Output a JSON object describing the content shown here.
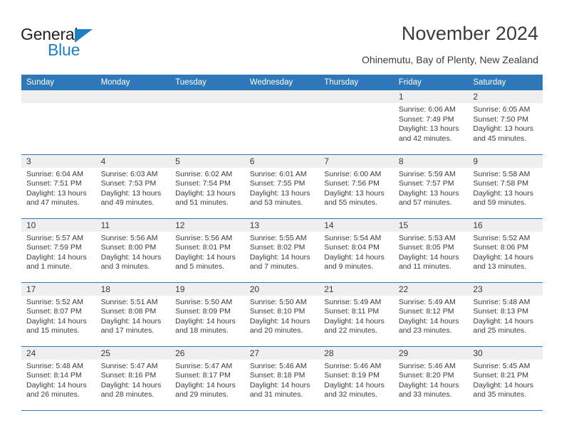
{
  "brand": {
    "logo_text_primary": "General",
    "logo_text_secondary": "Blue",
    "logo_icon": "triangle-icon",
    "primary_color": "#2e77b8",
    "logo_blue": "#1e7fc4",
    "header_bg": "#2e77b8",
    "daynum_bg": "#efefef"
  },
  "header": {
    "title": "November 2024",
    "subtitle": "Ohinemutu, Bay of Plenty, New Zealand"
  },
  "calendar": {
    "weekday_headers": [
      "Sunday",
      "Monday",
      "Tuesday",
      "Wednesday",
      "Thursday",
      "Friday",
      "Saturday"
    ],
    "weeks": [
      [
        {
          "day": "",
          "sunrise": "",
          "sunset": "",
          "daylight1": "",
          "daylight2": "",
          "blank": true
        },
        {
          "day": "",
          "sunrise": "",
          "sunset": "",
          "daylight1": "",
          "daylight2": "",
          "blank": true
        },
        {
          "day": "",
          "sunrise": "",
          "sunset": "",
          "daylight1": "",
          "daylight2": "",
          "blank": true
        },
        {
          "day": "",
          "sunrise": "",
          "sunset": "",
          "daylight1": "",
          "daylight2": "",
          "blank": true
        },
        {
          "day": "",
          "sunrise": "",
          "sunset": "",
          "daylight1": "",
          "daylight2": "",
          "blank": true
        },
        {
          "day": "1",
          "sunrise": "Sunrise: 6:06 AM",
          "sunset": "Sunset: 7:49 PM",
          "daylight1": "Daylight: 13 hours",
          "daylight2": "and 42 minutes.",
          "blank": false
        },
        {
          "day": "2",
          "sunrise": "Sunrise: 6:05 AM",
          "sunset": "Sunset: 7:50 PM",
          "daylight1": "Daylight: 13 hours",
          "daylight2": "and 45 minutes.",
          "blank": false
        }
      ],
      [
        {
          "day": "3",
          "sunrise": "Sunrise: 6:04 AM",
          "sunset": "Sunset: 7:51 PM",
          "daylight1": "Daylight: 13 hours",
          "daylight2": "and 47 minutes.",
          "blank": false
        },
        {
          "day": "4",
          "sunrise": "Sunrise: 6:03 AM",
          "sunset": "Sunset: 7:53 PM",
          "daylight1": "Daylight: 13 hours",
          "daylight2": "and 49 minutes.",
          "blank": false
        },
        {
          "day": "5",
          "sunrise": "Sunrise: 6:02 AM",
          "sunset": "Sunset: 7:54 PM",
          "daylight1": "Daylight: 13 hours",
          "daylight2": "and 51 minutes.",
          "blank": false
        },
        {
          "day": "6",
          "sunrise": "Sunrise: 6:01 AM",
          "sunset": "Sunset: 7:55 PM",
          "daylight1": "Daylight: 13 hours",
          "daylight2": "and 53 minutes.",
          "blank": false
        },
        {
          "day": "7",
          "sunrise": "Sunrise: 6:00 AM",
          "sunset": "Sunset: 7:56 PM",
          "daylight1": "Daylight: 13 hours",
          "daylight2": "and 55 minutes.",
          "blank": false
        },
        {
          "day": "8",
          "sunrise": "Sunrise: 5:59 AM",
          "sunset": "Sunset: 7:57 PM",
          "daylight1": "Daylight: 13 hours",
          "daylight2": "and 57 minutes.",
          "blank": false
        },
        {
          "day": "9",
          "sunrise": "Sunrise: 5:58 AM",
          "sunset": "Sunset: 7:58 PM",
          "daylight1": "Daylight: 13 hours",
          "daylight2": "and 59 minutes.",
          "blank": false
        }
      ],
      [
        {
          "day": "10",
          "sunrise": "Sunrise: 5:57 AM",
          "sunset": "Sunset: 7:59 PM",
          "daylight1": "Daylight: 14 hours",
          "daylight2": "and 1 minute.",
          "blank": false
        },
        {
          "day": "11",
          "sunrise": "Sunrise: 5:56 AM",
          "sunset": "Sunset: 8:00 PM",
          "daylight1": "Daylight: 14 hours",
          "daylight2": "and 3 minutes.",
          "blank": false
        },
        {
          "day": "12",
          "sunrise": "Sunrise: 5:56 AM",
          "sunset": "Sunset: 8:01 PM",
          "daylight1": "Daylight: 14 hours",
          "daylight2": "and 5 minutes.",
          "blank": false
        },
        {
          "day": "13",
          "sunrise": "Sunrise: 5:55 AM",
          "sunset": "Sunset: 8:02 PM",
          "daylight1": "Daylight: 14 hours",
          "daylight2": "and 7 minutes.",
          "blank": false
        },
        {
          "day": "14",
          "sunrise": "Sunrise: 5:54 AM",
          "sunset": "Sunset: 8:04 PM",
          "daylight1": "Daylight: 14 hours",
          "daylight2": "and 9 minutes.",
          "blank": false
        },
        {
          "day": "15",
          "sunrise": "Sunrise: 5:53 AM",
          "sunset": "Sunset: 8:05 PM",
          "daylight1": "Daylight: 14 hours",
          "daylight2": "and 11 minutes.",
          "blank": false
        },
        {
          "day": "16",
          "sunrise": "Sunrise: 5:52 AM",
          "sunset": "Sunset: 8:06 PM",
          "daylight1": "Daylight: 14 hours",
          "daylight2": "and 13 minutes.",
          "blank": false
        }
      ],
      [
        {
          "day": "17",
          "sunrise": "Sunrise: 5:52 AM",
          "sunset": "Sunset: 8:07 PM",
          "daylight1": "Daylight: 14 hours",
          "daylight2": "and 15 minutes.",
          "blank": false
        },
        {
          "day": "18",
          "sunrise": "Sunrise: 5:51 AM",
          "sunset": "Sunset: 8:08 PM",
          "daylight1": "Daylight: 14 hours",
          "daylight2": "and 17 minutes.",
          "blank": false
        },
        {
          "day": "19",
          "sunrise": "Sunrise: 5:50 AM",
          "sunset": "Sunset: 8:09 PM",
          "daylight1": "Daylight: 14 hours",
          "daylight2": "and 18 minutes.",
          "blank": false
        },
        {
          "day": "20",
          "sunrise": "Sunrise: 5:50 AM",
          "sunset": "Sunset: 8:10 PM",
          "daylight1": "Daylight: 14 hours",
          "daylight2": "and 20 minutes.",
          "blank": false
        },
        {
          "day": "21",
          "sunrise": "Sunrise: 5:49 AM",
          "sunset": "Sunset: 8:11 PM",
          "daylight1": "Daylight: 14 hours",
          "daylight2": "and 22 minutes.",
          "blank": false
        },
        {
          "day": "22",
          "sunrise": "Sunrise: 5:49 AM",
          "sunset": "Sunset: 8:12 PM",
          "daylight1": "Daylight: 14 hours",
          "daylight2": "and 23 minutes.",
          "blank": false
        },
        {
          "day": "23",
          "sunrise": "Sunrise: 5:48 AM",
          "sunset": "Sunset: 8:13 PM",
          "daylight1": "Daylight: 14 hours",
          "daylight2": "and 25 minutes.",
          "blank": false
        }
      ],
      [
        {
          "day": "24",
          "sunrise": "Sunrise: 5:48 AM",
          "sunset": "Sunset: 8:14 PM",
          "daylight1": "Daylight: 14 hours",
          "daylight2": "and 26 minutes.",
          "blank": false
        },
        {
          "day": "25",
          "sunrise": "Sunrise: 5:47 AM",
          "sunset": "Sunset: 8:16 PM",
          "daylight1": "Daylight: 14 hours",
          "daylight2": "and 28 minutes.",
          "blank": false
        },
        {
          "day": "26",
          "sunrise": "Sunrise: 5:47 AM",
          "sunset": "Sunset: 8:17 PM",
          "daylight1": "Daylight: 14 hours",
          "daylight2": "and 29 minutes.",
          "blank": false
        },
        {
          "day": "27",
          "sunrise": "Sunrise: 5:46 AM",
          "sunset": "Sunset: 8:18 PM",
          "daylight1": "Daylight: 14 hours",
          "daylight2": "and 31 minutes.",
          "blank": false
        },
        {
          "day": "28",
          "sunrise": "Sunrise: 5:46 AM",
          "sunset": "Sunset: 8:19 PM",
          "daylight1": "Daylight: 14 hours",
          "daylight2": "and 32 minutes.",
          "blank": false
        },
        {
          "day": "29",
          "sunrise": "Sunrise: 5:46 AM",
          "sunset": "Sunset: 8:20 PM",
          "daylight1": "Daylight: 14 hours",
          "daylight2": "and 33 minutes.",
          "blank": false
        },
        {
          "day": "30",
          "sunrise": "Sunrise: 5:45 AM",
          "sunset": "Sunset: 8:21 PM",
          "daylight1": "Daylight: 14 hours",
          "daylight2": "and 35 minutes.",
          "blank": false
        }
      ]
    ]
  }
}
